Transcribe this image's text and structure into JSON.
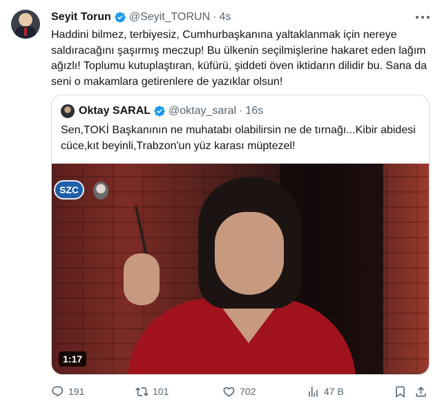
{
  "tweet": {
    "author_name": "Seyit Torun",
    "author_handle": "@Seyit_TORUN",
    "separator": "·",
    "time": "4s",
    "text": "Haddini bilmez, terbiyesiz, Cumhurbaşkanına yaltaklanmak için nereye saldıracağını şaşırmış meczup! Bu ülkenin seçilmişlerine hakaret eden lağım ağızlı! Toplumu kutuplaştıran, küfürü, şiddeti öven iktidarın dilidir bu. Sana da seni o makamlara getirenlere de yazıklar olsun!",
    "avatar_icon": "profile-photo",
    "more_icon": "ellipsis-icon"
  },
  "quote": {
    "author_name": "Oktay SARAL",
    "author_handle": "@oktay_saral",
    "separator": "·",
    "time": "16s",
    "text": "Sen,TOKİ Başkanının ne muhatabı olabilirsin ne de tırnağı...Kibir abidesi cüce,kıt beyinli,Trabzon'un yüz karası müptezel!",
    "video": {
      "channel_logo": "SZC",
      "duration": "1:17"
    }
  },
  "actions": {
    "reply_count": "191",
    "retweet_count": "101",
    "like_count": "702",
    "views_count": "47 B"
  },
  "colors": {
    "verified": "#1d9bf0",
    "secondary_text": "#536471",
    "border": "#cfd9de",
    "text": "#0f1419"
  }
}
